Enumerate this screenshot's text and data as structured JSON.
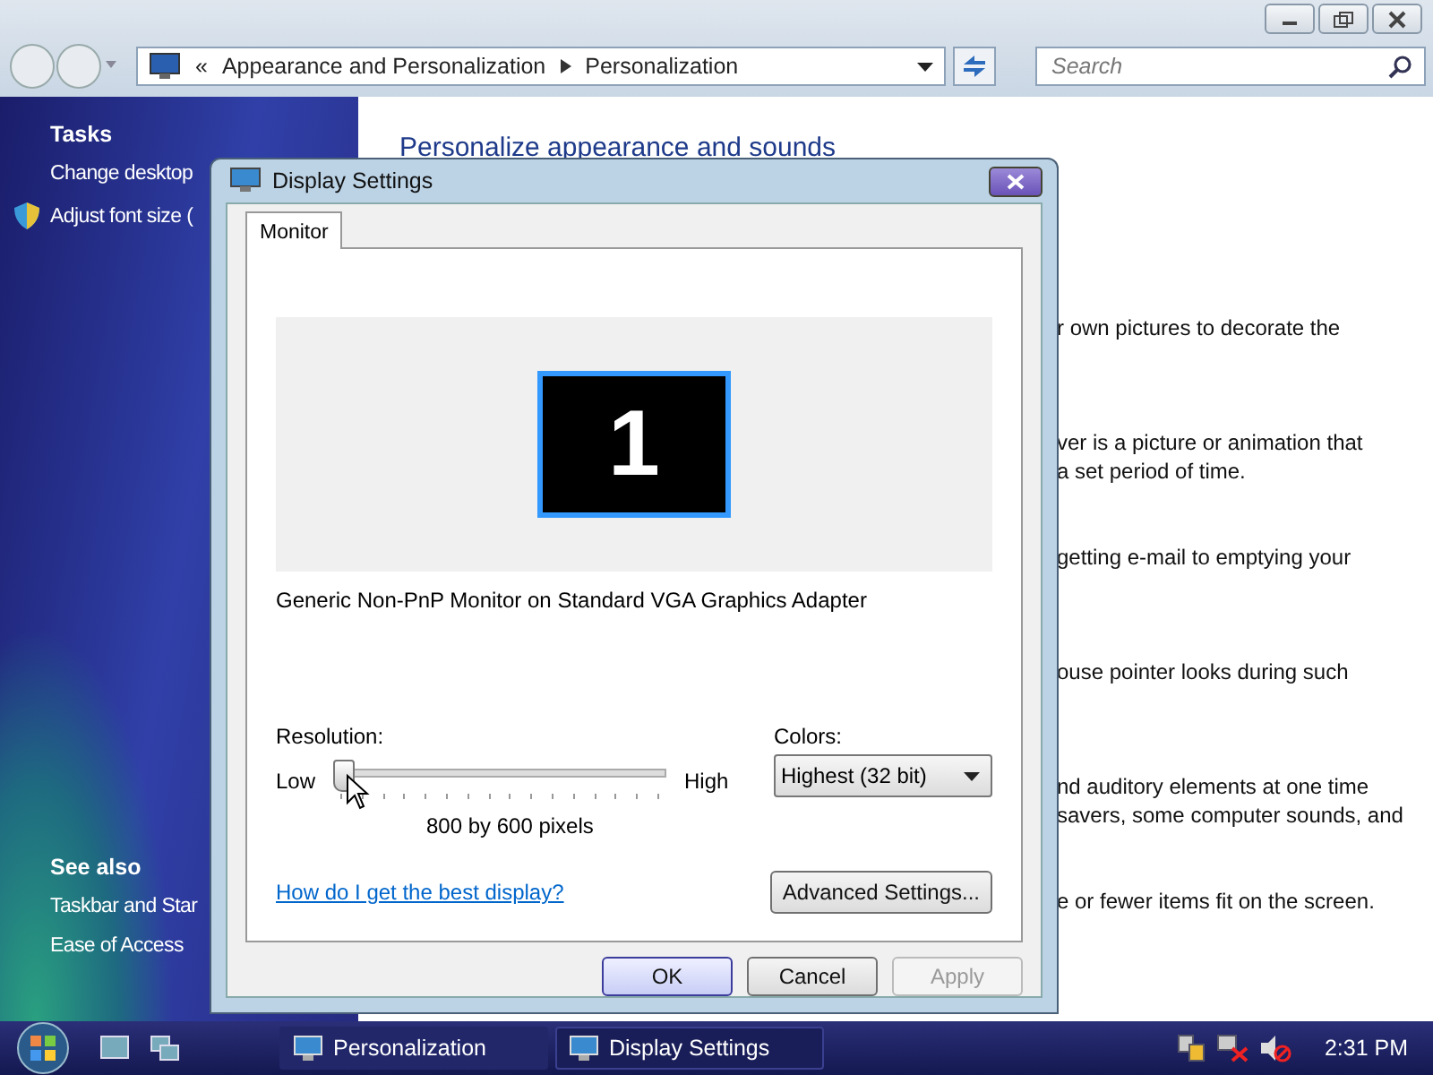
{
  "address_bar": {
    "overflow": "«",
    "crumbs": [
      "Appearance and Personalization",
      "Personalization"
    ]
  },
  "search": {
    "placeholder": "Search"
  },
  "sidebar": {
    "tasks_heading": "Tasks",
    "tasks": [
      {
        "label": "Change desktop",
        "shield": false
      },
      {
        "label": "Adjust font size (",
        "shield": true
      }
    ],
    "see_also_heading": "See also",
    "see_also": [
      "Taskbar and Star",
      "Ease of Access"
    ]
  },
  "content": {
    "heading": "Personalize appearance and sounds",
    "descriptions": [
      "r own pictures to decorate the",
      "ver is a picture or animation that\na set period of time.",
      "getting e-mail to emptying your",
      "ouse pointer looks during such",
      "nd auditory elements at one time\n savers, some computer sounds, and",
      "e or fewer items fit on the screen."
    ]
  },
  "dialog": {
    "title": "Display Settings",
    "tabs": [
      {
        "label": "Monitor",
        "selected": true
      }
    ],
    "monitor_number": "1",
    "monitor_name": "Generic Non-PnP Monitor on Standard VGA Graphics Adapter",
    "resolution_label": "Resolution:",
    "low_label": "Low",
    "high_label": "High",
    "resolution": {
      "level": 0
    },
    "resolution_reading": "800 by 600 pixels",
    "colors_label": "Colors:",
    "colors_value": "Highest (32 bit)",
    "help_link": "How do I get the best display?",
    "advanced_button": "Advanced Settings...",
    "buttons": [
      {
        "label": "OK",
        "default": true,
        "disabled": false
      },
      {
        "label": "Cancel",
        "default": false,
        "disabled": false
      },
      {
        "label": "Apply",
        "default": false,
        "disabled": true
      }
    ]
  },
  "taskbar": {
    "tasks": [
      {
        "label": "Personalization",
        "selected": false
      },
      {
        "label": "Display Settings",
        "selected": true
      }
    ],
    "clock": "2:31 PM"
  }
}
